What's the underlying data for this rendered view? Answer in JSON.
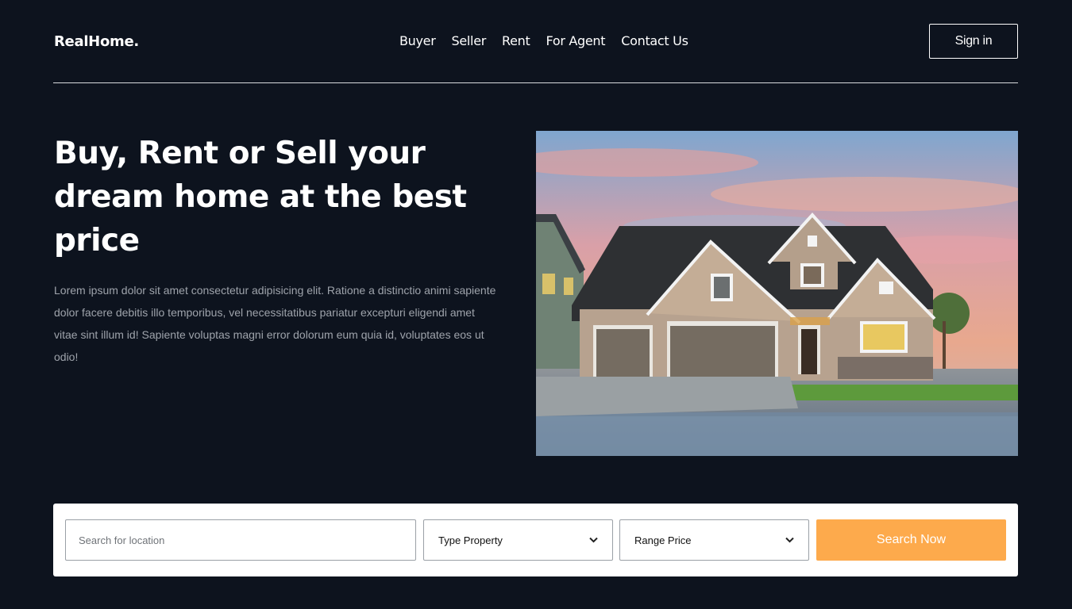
{
  "header": {
    "logo": "RealHome.",
    "menu": [
      "Buyer",
      "Seller",
      "Rent",
      "For Agent",
      "Contact Us"
    ],
    "signin_label": "Sign in"
  },
  "hero": {
    "title": "Buy, Rent or Sell your dream home at the best price",
    "text": "Lorem ipsum dolor sit amet consectetur adipisicing elit. Ratione a distinctio animi sapiente dolor facere debitis illo temporibus, vel necessitatibus pariatur excepturi eligendi amet vitae sint illum id! Sapiente voluptas magni error dolorum eum quia id, voluptates eos ut odio!"
  },
  "search": {
    "location_placeholder": "Search for location",
    "type_property": "Type Property",
    "range_price": "Range Price",
    "button_label": "Search Now"
  },
  "colors": {
    "background": "#0d131e",
    "accent": "#fdaa4c",
    "muted_text": "#9ea3ab"
  }
}
